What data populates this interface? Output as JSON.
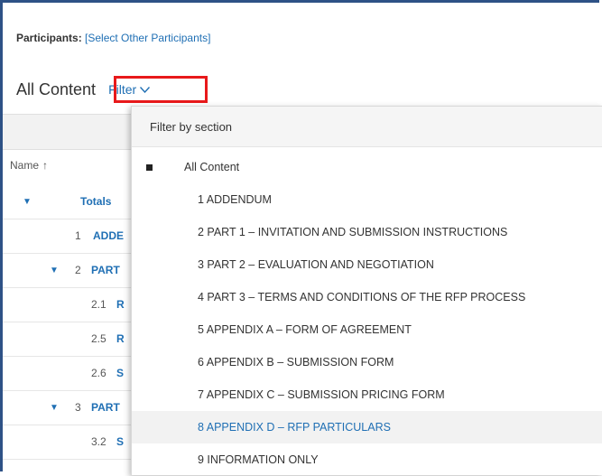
{
  "participants": {
    "label": "Participants:",
    "link": "[Select Other Participants]"
  },
  "heading": "All Content",
  "filter": {
    "label": "Filter"
  },
  "table": {
    "name_header": "Name",
    "sort_arrow": "↑",
    "rows": [
      {
        "num": "",
        "text": "Totals",
        "expanded": true
      },
      {
        "num": "1",
        "text": "ADDE",
        "expanded": false
      },
      {
        "num": "2",
        "text": "PART",
        "expanded": true
      },
      {
        "num": "2.1",
        "text": "R",
        "expanded": false
      },
      {
        "num": "2.5",
        "text": "R",
        "expanded": false
      },
      {
        "num": "2.6",
        "text": "S",
        "expanded": false
      },
      {
        "num": "3",
        "text": "PART",
        "expanded": true
      },
      {
        "num": "3.2",
        "text": "S",
        "expanded": false
      }
    ]
  },
  "dropdown": {
    "header": "Filter by section",
    "items": [
      {
        "label": "All Content",
        "selected": true
      },
      {
        "label": "1 ADDENDUM"
      },
      {
        "label": "2 PART 1 – INVITATION AND SUBMISSION INSTRUCTIONS"
      },
      {
        "label": "3 PART 2 – EVALUATION AND NEGOTIATION"
      },
      {
        "label": "4 PART 3 – TERMS AND CONDITIONS OF THE RFP PROCESS"
      },
      {
        "label": "5 APPENDIX A – FORM OF AGREEMENT"
      },
      {
        "label": "6 APPENDIX B – SUBMISSION FORM"
      },
      {
        "label": "7 APPENDIX C – SUBMISSION PRICING FORM"
      },
      {
        "label": "8 APPENDIX D – RFP PARTICULARS",
        "hovered": true
      },
      {
        "label": "9 INFORMATION ONLY"
      }
    ]
  },
  "colors": {
    "link": "#1f6fb4",
    "frame": "#2e5286",
    "highlight_box": "#e8191b"
  }
}
